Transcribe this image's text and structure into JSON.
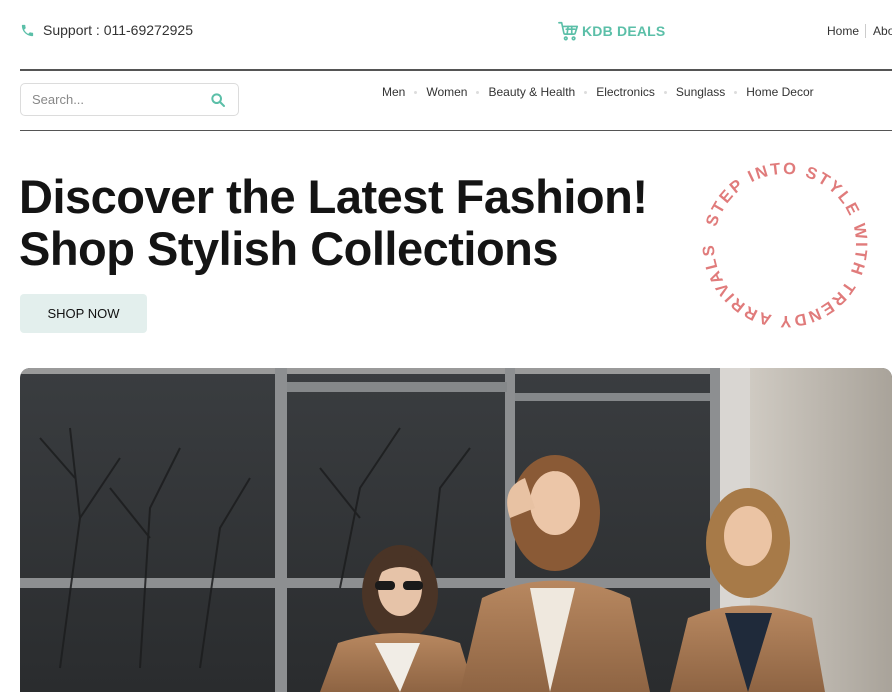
{
  "header": {
    "support_text": "Support : 011-69272925",
    "logo_text": "KDB DEALS",
    "nav_items": [
      "Home",
      "Abo"
    ]
  },
  "search": {
    "placeholder": "Search..."
  },
  "categories": [
    "Men",
    "Women",
    "Beauty & Health",
    "Electronics",
    "Sunglass",
    "Home Decor"
  ],
  "hero": {
    "line1": "Discover the Latest Fashion!",
    "line2": "Shop Stylish Collections",
    "button": "SHOP NOW",
    "circle_text": "STEP INTO STYLE WITH TRENDY ARRIVALS -"
  },
  "icons": {
    "phone": "phone-icon",
    "cart": "cart-icon",
    "search": "search-icon"
  },
  "colors": {
    "accent": "#5bbfa8",
    "button_bg": "#e3efed",
    "circle_text": "#e07b7b"
  }
}
